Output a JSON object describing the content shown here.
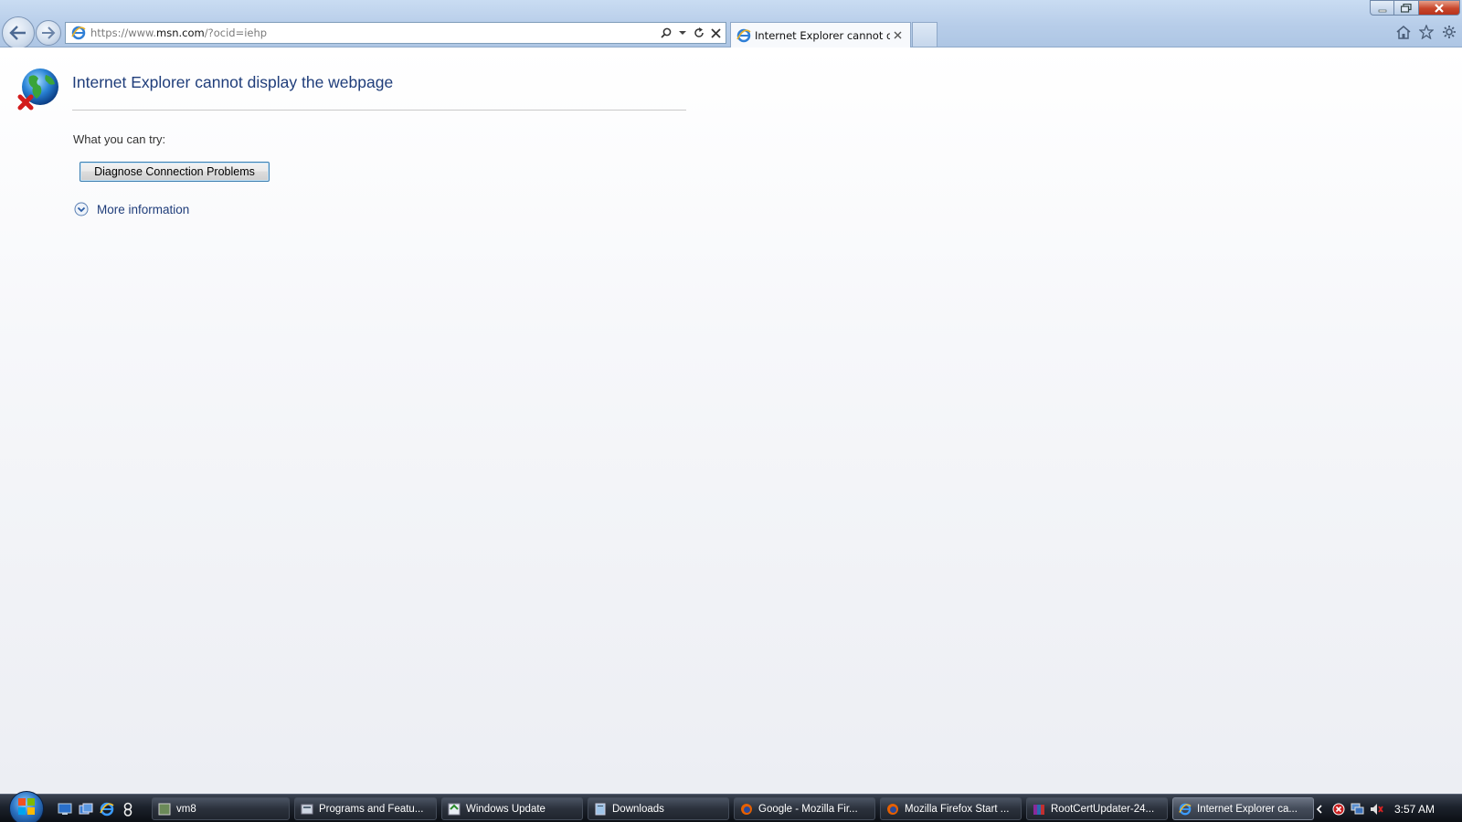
{
  "window": {
    "address_url_prefix": "https://www.",
    "address_url_host": "msn.com",
    "address_url_suffix": "/?ocid=iehp",
    "tab_title": "Internet Explorer cannot dis...",
    "icons": [
      "back-icon",
      "forward-icon",
      "ie-page-icon",
      "search-icon",
      "refresh-icon",
      "stop-icon",
      "home-icon",
      "favorites-icon",
      "tools-icon",
      "minimize-icon",
      "maximize-icon",
      "close-icon"
    ]
  },
  "page": {
    "title": "Internet Explorer cannot display the webpage",
    "try_label": "What you can try:",
    "diagnose_button": "Diagnose Connection Problems",
    "more_info_label": "More information"
  },
  "taskbar": {
    "items": [
      {
        "label": "vm8",
        "icon": "app-icon"
      },
      {
        "label": "Programs and Featu...",
        "icon": "control-panel-icon"
      },
      {
        "label": "Windows Update",
        "icon": "windows-update-icon"
      },
      {
        "label": "Downloads",
        "icon": "folder-icon"
      },
      {
        "label": "Google - Mozilla Fir...",
        "icon": "firefox-icon"
      },
      {
        "label": "Mozilla Firefox Start ...",
        "icon": "firefox-icon"
      },
      {
        "label": "RootCertUpdater-24...",
        "icon": "archive-icon"
      },
      {
        "label": "Internet Explorer ca...",
        "icon": "ie-icon",
        "active": true
      }
    ],
    "clock": "3:57 AM"
  },
  "colors": {
    "title_blue": "#1f3d7a",
    "chrome_blue": "#b7cde9",
    "close_red": "#c8462b"
  }
}
